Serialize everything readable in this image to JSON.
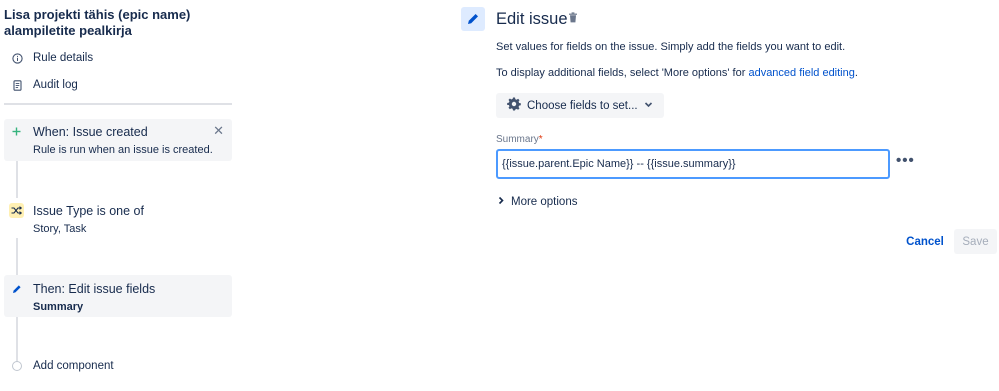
{
  "sidebar": {
    "rule_title": "Lisa projekti tähis (epic name) alampiletite pealkirja",
    "nav": [
      {
        "label": "Rule details",
        "icon": "info-icon"
      },
      {
        "label": "Audit log",
        "icon": "document-icon"
      }
    ],
    "components": [
      {
        "title": "When: Issue created",
        "subtitle": "Rule is run when an issue is created.",
        "icon": "plus-icon",
        "color": "#36b37e"
      },
      {
        "title": "Issue Type is one of",
        "subtitle": "Story, Task",
        "icon": "shuffle-icon",
        "color": "#ffab00"
      },
      {
        "title": "Then: Edit issue fields",
        "subtitle": "Summary",
        "icon": "pencil-icon",
        "color": "#0052cc"
      }
    ],
    "add_component": "Add component"
  },
  "main": {
    "title": "Edit issue",
    "description_1": "Set values for fields on the issue. Simply add the fields you want to edit.",
    "description_2_prefix": "To display additional fields, select 'More options' for ",
    "description_2_link": "advanced field editing",
    "description_2_suffix": ".",
    "choose_fields_label": "Choose fields to set...",
    "summary_label": "Summary",
    "required_mark": "*",
    "summary_value": "{{issue.parent.Epic Name}} -- {{issue.summary}}",
    "more_options_label": "More options",
    "cancel_label": "Cancel",
    "save_label": "Save"
  },
  "colors": {
    "accent": "#0052cc",
    "focus_border": "#4c9aff",
    "selected_bg": "#f4f5f7"
  }
}
